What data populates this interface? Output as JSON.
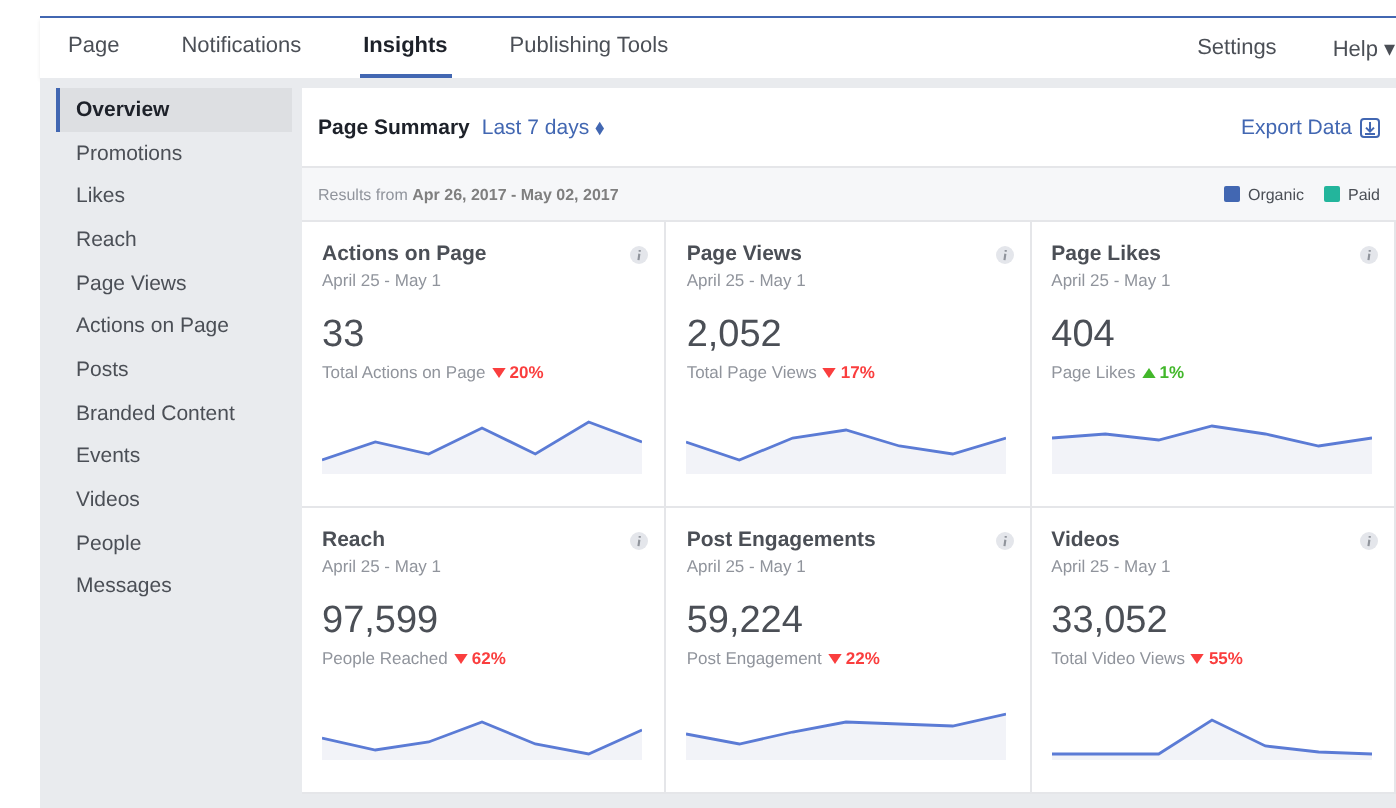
{
  "top_nav": {
    "tabs": [
      {
        "label": "Page",
        "selected": false
      },
      {
        "label": "Notifications",
        "selected": false
      },
      {
        "label": "Insights",
        "selected": true
      },
      {
        "label": "Publishing Tools",
        "selected": false
      }
    ],
    "right": [
      {
        "label": "Settings"
      },
      {
        "label": "Help ▾"
      }
    ]
  },
  "sidebar": {
    "items": [
      {
        "label": "Overview",
        "selected": true
      },
      {
        "label": "Promotions",
        "selected": false
      },
      {
        "label": "Likes",
        "selected": false
      },
      {
        "label": "Reach",
        "selected": false
      },
      {
        "label": "Page Views",
        "selected": false
      },
      {
        "label": "Actions on Page",
        "selected": false
      },
      {
        "label": "Posts",
        "selected": false
      },
      {
        "label": "Branded Content",
        "selected": false
      },
      {
        "label": "Events",
        "selected": false
      },
      {
        "label": "Videos",
        "selected": false
      },
      {
        "label": "People",
        "selected": false
      },
      {
        "label": "Messages",
        "selected": false
      }
    ]
  },
  "summary": {
    "title": "Page Summary",
    "period": "Last 7 days ⬧",
    "export": "Export Data",
    "results": "Results from **Apr 26, 2017 - May 02, 2017**",
    "legend": [
      {
        "label": "Organic",
        "color": "#4267b2"
      },
      {
        "label": "Paid",
        "color": "#23b59c"
      }
    ]
  },
  "cards": [
    {
      "title": "Actions on Page",
      "date": "April 25 - May 1",
      "value": "33",
      "caption": "Total Actions on Page",
      "rising": false,
      "change": "20%"
    },
    {
      "title": "Page Views",
      "date": "April 25 - May 1",
      "value": "2,052",
      "caption": "Total Page Views",
      "rising": false,
      "change": "17%"
    },
    {
      "title": "Page Likes",
      "date": "April 25 - May 1",
      "value": "404",
      "caption": "Page Likes",
      "rising": true,
      "change": "1%"
    },
    {
      "title": "Reach",
      "date": "April 25 - May 1",
      "value": "97,599",
      "caption": "People Reached",
      "rising": false,
      "change": "62%"
    },
    {
      "title": "Post Engagements",
      "date": "April 25 - May 1",
      "value": "59,224",
      "caption": "Post Engagement",
      "rising": false,
      "change": "22%"
    },
    {
      "title": "Videos",
      "date": "April 25 - May 1",
      "value": "33,052",
      "caption": "Total Video Views",
      "rising": false,
      "change": "55%"
    }
  ]
}
